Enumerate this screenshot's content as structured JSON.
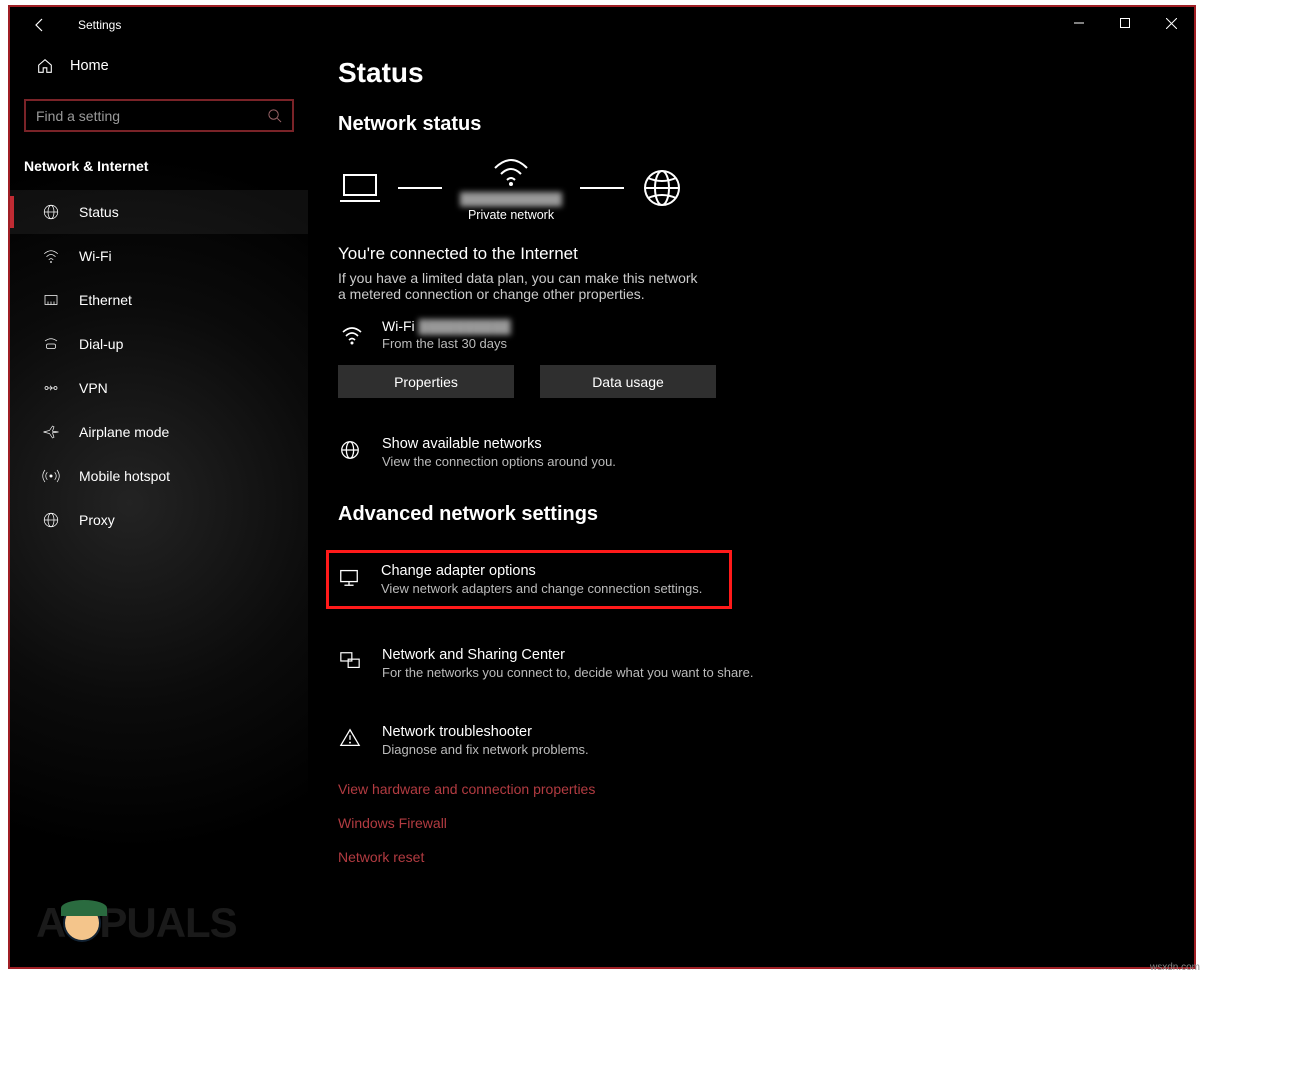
{
  "window": {
    "title": "Settings"
  },
  "sidebar": {
    "home": "Home",
    "search_placeholder": "Find a setting",
    "category": "Network & Internet",
    "items": [
      {
        "label": "Status"
      },
      {
        "label": "Wi-Fi"
      },
      {
        "label": "Ethernet"
      },
      {
        "label": "Dial-up"
      },
      {
        "label": "VPN"
      },
      {
        "label": "Airplane mode"
      },
      {
        "label": "Mobile hotspot"
      },
      {
        "label": "Proxy"
      }
    ]
  },
  "main": {
    "page_title": "Status",
    "network_status_heading": "Network status",
    "network_type": "Private network",
    "connected_title": "You're connected to the Internet",
    "connected_sub": "If you have a limited data plan, you can make this network a metered connection or change other properties.",
    "connection_name": "Wi-Fi",
    "connection_sub": "From the last 30 days",
    "properties_btn": "Properties",
    "data_usage_btn": "Data usage",
    "show_networks_title": "Show available networks",
    "show_networks_sub": "View the connection options around you.",
    "advanced_heading": "Advanced network settings",
    "change_adapter_title": "Change adapter options",
    "change_adapter_sub": "View network adapters and change connection settings.",
    "sharing_title": "Network and Sharing Center",
    "sharing_sub": "For the networks you connect to, decide what you want to share.",
    "troubleshoot_title": "Network troubleshooter",
    "troubleshoot_sub": "Diagnose and fix network problems.",
    "links": [
      "View hardware and connection properties",
      "Windows Firewall",
      "Network reset"
    ]
  },
  "watermark": {
    "site_logo": "APPUALS",
    "corner": "wsxdn.com"
  }
}
